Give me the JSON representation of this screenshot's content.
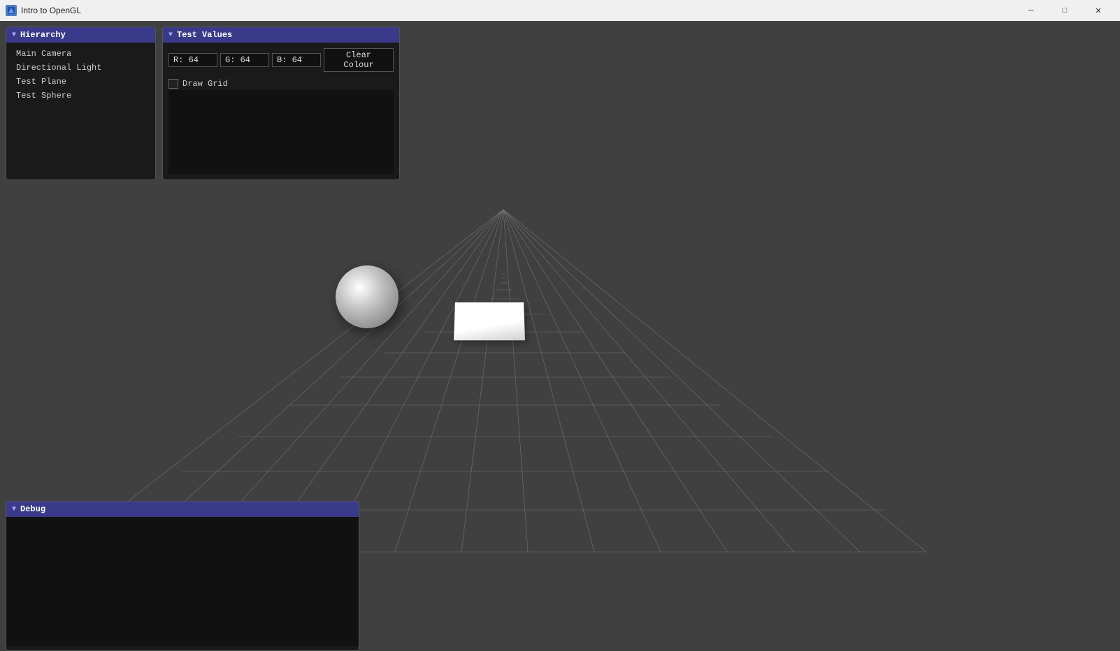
{
  "titleBar": {
    "appTitle": "Intro to OpenGL",
    "minimizeLabel": "─",
    "maximizeLabel": "□",
    "closeLabel": "✕"
  },
  "hierarchy": {
    "panelTitle": "Hierarchy",
    "items": [
      {
        "label": "Main Camera"
      },
      {
        "label": "Directional Light"
      },
      {
        "label": "Test Plane"
      },
      {
        "label": "Test Sphere"
      }
    ]
  },
  "testValues": {
    "panelTitle": "Test Values",
    "rField": "R: 64",
    "gField": "G: 64",
    "bField": "B: 64",
    "clearColourBtn": "Clear Colour",
    "drawGridLabel": "Draw Grid"
  },
  "debug": {
    "panelTitle": "Debug"
  }
}
